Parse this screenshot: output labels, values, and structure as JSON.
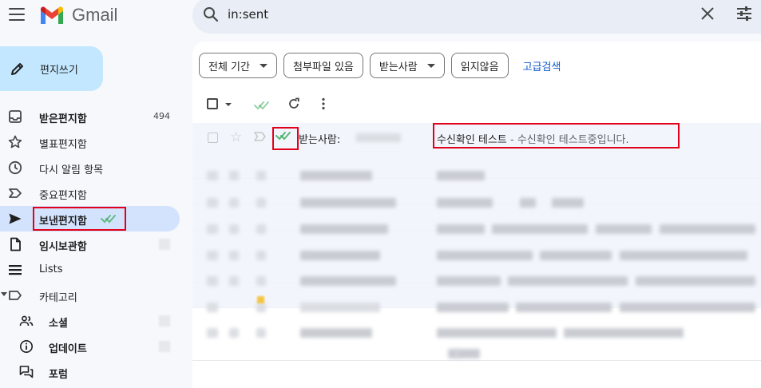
{
  "app": {
    "brand": "Gmail"
  },
  "search": {
    "query": "in:sent"
  },
  "compose": {
    "label": "편지쓰기"
  },
  "sidebar": {
    "items": [
      {
        "label": "받은편지함",
        "count": "494",
        "icon": "inbox-icon"
      },
      {
        "label": "별표편지함",
        "icon": "star-icon"
      },
      {
        "label": "다시 알림 항목",
        "icon": "clock-icon"
      },
      {
        "label": "중요편지함",
        "icon": "important-icon"
      },
      {
        "label": "보낸편지함",
        "icon": "send-icon"
      },
      {
        "label": "임시보관함",
        "icon": "draft-icon"
      },
      {
        "label": "Lists",
        "icon": "lists-icon"
      },
      {
        "label": "카테고리",
        "icon": "label-icon"
      }
    ],
    "categories": [
      {
        "label": "소셜",
        "icon": "people-icon"
      },
      {
        "label": "업데이트",
        "icon": "info-icon"
      },
      {
        "label": "포럼",
        "icon": "forum-icon"
      }
    ]
  },
  "filters": {
    "chips": [
      {
        "label": "전체 기간",
        "dropdown": true
      },
      {
        "label": "첨부파일 있음",
        "dropdown": false
      },
      {
        "label": "받는사람",
        "dropdown": true
      },
      {
        "label": "읽지않음",
        "dropdown": false
      }
    ],
    "advanced_link": "고급검색"
  },
  "email": {
    "recipient_prefix": "받는사람:",
    "subject": "수신확인 테스트",
    "separator": " - ",
    "snippet": "수신확인 테스트중입니다."
  },
  "colors": {
    "accent_blue": "#0b57d0",
    "active_nav": "#d3e3fd",
    "compose": "#c2e7ff",
    "read_receipt_green": "#34a853",
    "highlight_red": "#e2001a"
  }
}
